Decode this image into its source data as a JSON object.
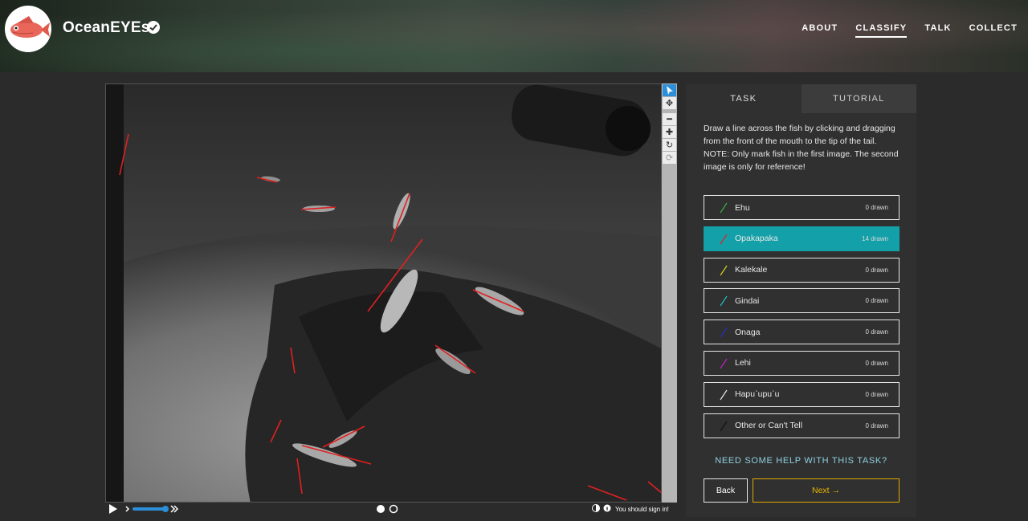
{
  "header": {
    "title": "OceanEYEs",
    "nav": [
      "ABOUT",
      "CLASSIFY",
      "TALK",
      "COLLECT"
    ],
    "active_nav": "CLASSIFY"
  },
  "panel": {
    "tabs": [
      "TASK",
      "TUTORIAL"
    ],
    "instructions_1": "Draw a line across the fish by clicking and dragging from the front of the mouth to the tip of the tail.",
    "instructions_2": "NOTE: Only mark fish in the first image. The second image is only for reference!",
    "choices": [
      {
        "label": "Ehu",
        "count": "0 drawn",
        "color": "#3cb043"
      },
      {
        "label": "Opakapaka",
        "count": "14 drawn",
        "color": "#e02020"
      },
      {
        "label": "Kalekale",
        "count": "0 drawn",
        "color": "#d8d020"
      },
      {
        "label": "Gindai",
        "count": "0 drawn",
        "color": "#20c0c0"
      },
      {
        "label": "Onaga",
        "count": "0 drawn",
        "color": "#2030c0"
      },
      {
        "label": "Lehi",
        "count": "0 drawn",
        "color": "#c020c0"
      },
      {
        "label": "Hapu`upu`u",
        "count": "0 drawn",
        "color": "#e8e8e8"
      },
      {
        "label": "Other or Can't Tell",
        "count": "0 drawn",
        "color": "#111111"
      }
    ],
    "selected_choice": "Opakapaka",
    "help": "NEED SOME HELP WITH THIS TASK?",
    "back_label": "Back",
    "next_label": "Next →"
  },
  "viewer": {
    "signin_text": "You should sign in!",
    "tools": [
      "pointer-icon",
      "move-icon",
      "zoom-out-icon",
      "zoom-in-icon",
      "rotate-icon",
      "reset-icon"
    ]
  }
}
